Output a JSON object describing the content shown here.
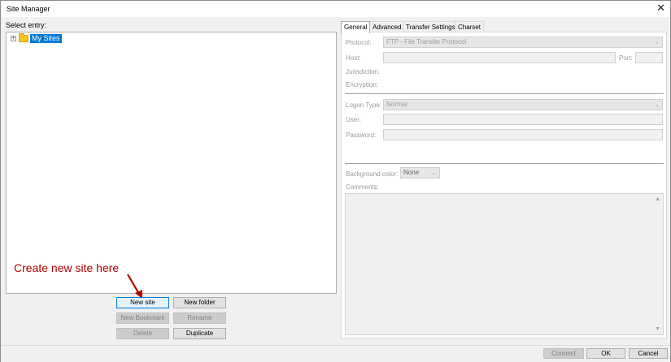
{
  "window": {
    "title": "Site Manager",
    "close_glyph": "✕"
  },
  "tree": {
    "label": "Select entry:",
    "expander_glyph": "+",
    "root": {
      "label": "My Sites",
      "icon": "folder-icon"
    }
  },
  "buttons": {
    "new_site": "New site",
    "new_folder": "New folder",
    "new_bookmark": "New Bookmark",
    "rename": "Rename",
    "delete": "Delete",
    "duplicate": "Duplicate"
  },
  "annotation": {
    "text": "Create new site here",
    "color": "#b00000"
  },
  "tabs": [
    "General",
    "Advanced",
    "Transfer Settings",
    "Charset"
  ],
  "general": {
    "protocol_label": "Protocol:",
    "protocol_value": "FTP - File Transfer Protocol",
    "host_label": "Host:",
    "port_label": "Port:",
    "jurisdiction_label": "Jurisdiction:",
    "encryption_label": "Encryption:",
    "logon_type_label": "Logon Type:",
    "logon_type_value": "Normal",
    "user_label": "User:",
    "password_label": "Password:",
    "background_color_label": "Background color:",
    "background_color_value": "None",
    "comments_label": "Comments:",
    "chevron": "⌄",
    "scroll_up": "▲",
    "scroll_down": "▼"
  },
  "footer": {
    "connect": "Connect",
    "ok": "OK",
    "cancel": "Cancel"
  },
  "colors": {
    "selection": "#0078d7",
    "annotation": "#b00000"
  }
}
